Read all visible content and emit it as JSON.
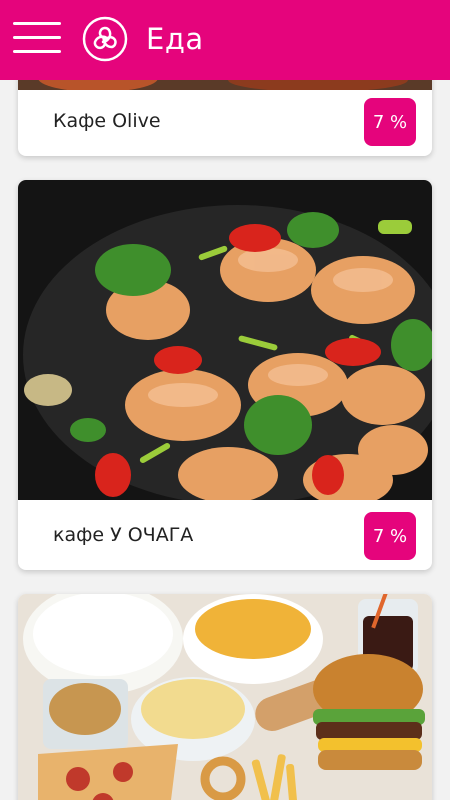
{
  "header": {
    "title": "Еда"
  },
  "cafes": [
    {
      "name": "Кафе Olive",
      "discount": "7 %"
    },
    {
      "name": "кафе У ОЧАГА",
      "discount": "7 %"
    }
  ],
  "colors": {
    "accent": "#e5047c",
    "background": "#f2f2f2",
    "card": "#ffffff"
  },
  "icons": {
    "menu": "hamburger-icon",
    "logo": "triple-spiral-logo"
  }
}
